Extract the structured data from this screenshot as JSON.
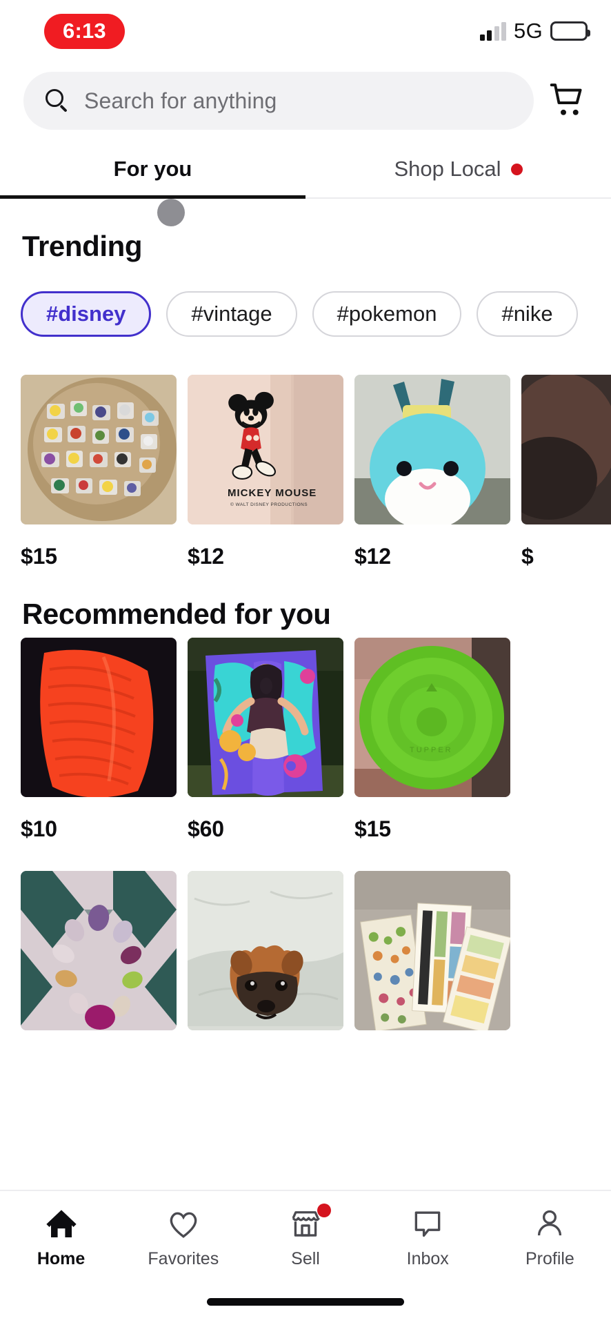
{
  "status_bar": {
    "time": "6:13",
    "network": "5G",
    "signal_icon": "signal-bars-icon",
    "battery_icon": "battery-full-icon",
    "time_pill_color": "#F01C22"
  },
  "search": {
    "placeholder": "Search for anything",
    "icon": "search-icon",
    "cart_icon": "shopping-cart-icon"
  },
  "tabs": [
    {
      "label": "For you",
      "active": true,
      "badge": false
    },
    {
      "label": "Shop Local",
      "active": false,
      "badge": true
    }
  ],
  "trending": {
    "title": "Trending",
    "chips": [
      {
        "label": "#disney",
        "selected": true
      },
      {
        "label": "#vintage",
        "selected": false
      },
      {
        "label": "#pokemon",
        "selected": false
      },
      {
        "label": "#nike",
        "selected": false
      }
    ],
    "items": [
      {
        "price": "$15",
        "alt": "disney-pin-collection-on-wood-board"
      },
      {
        "price": "$12",
        "alt": "mickey-mouse-glass-mug"
      },
      {
        "price": "$12",
        "alt": "blue-squishmallow-plush"
      },
      {
        "price": "$",
        "alt": "partially-visible-dark-item"
      }
    ]
  },
  "recommended": {
    "title": "Recommended for you",
    "row1": [
      {
        "price": "$10",
        "alt": "orange-knit-blanket"
      },
      {
        "price": "$60",
        "alt": "colorful-painted-canvas-art"
      },
      {
        "price": "$15",
        "alt": "green-plastic-bowl-lid"
      }
    ],
    "row2": [
      {
        "alt": "beaded-bracelet-on-quilt"
      },
      {
        "alt": "brown-puppy-on-blanket"
      },
      {
        "alt": "scrapbook-sticker-sheets"
      }
    ]
  },
  "bottom_nav": [
    {
      "label": "Home",
      "icon": "home-icon",
      "active": true,
      "badge": false
    },
    {
      "label": "Favorites",
      "icon": "heart-icon",
      "active": false,
      "badge": false
    },
    {
      "label": "Sell",
      "icon": "storefront-icon",
      "active": false,
      "badge": true
    },
    {
      "label": "Inbox",
      "icon": "chat-bubble-icon",
      "active": false,
      "badge": false
    },
    {
      "label": "Profile",
      "icon": "person-icon",
      "active": false,
      "badge": false
    }
  ],
  "colors": {
    "accent_purple": "#4230CC",
    "badge_red": "#D5141E",
    "search_bg": "#F2F2F4"
  }
}
